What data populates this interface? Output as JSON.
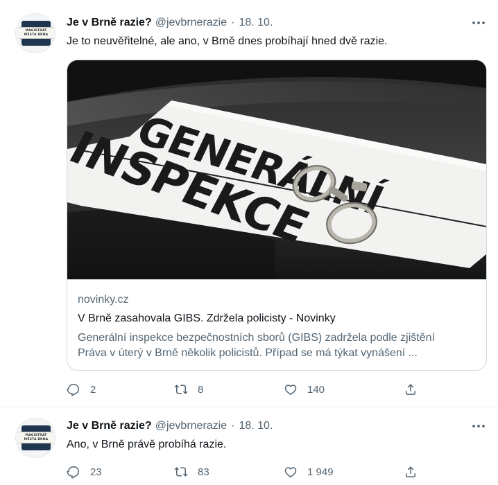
{
  "tweets": [
    {
      "author_name": "Je v Brně razie?",
      "author_handle": "@jevbrnerazie",
      "separator": "·",
      "date": "18. 10.",
      "text": "Je to neuvěřitelné, ale ano, v Brně dnes probíhají hned dvě razie.",
      "avatar_sign_line1": "MAGISTRÁT",
      "avatar_sign_line2": "MĚSTA BRNA",
      "card": {
        "image_alt": "Car hood with a sign reading GENERÁLNÍ INSPEKCE and handcuffs",
        "image_sign_line1": "GENERÁLNÍ",
        "image_sign_line2": "INSPEKCE",
        "domain": "novinky.cz",
        "title": "V Brně zasahovala GIBS. Zdržela policisty - Novinky",
        "description_line1": "Generální inspekce bezpečnostních sborů (GIBS) zadržela podle zjištění",
        "description_line2": "Práva v úterý v Brně několik policistů. Případ se má týkat vynášení ..."
      },
      "replies": "2",
      "retweets": "8",
      "likes": "140"
    },
    {
      "author_name": "Je v Brně razie?",
      "author_handle": "@jevbrnerazie",
      "separator": "·",
      "date": "18. 10.",
      "text": "Ano, v Brně právě probíhá razie.",
      "avatar_sign_line1": "MAGISTRÁT",
      "avatar_sign_line2": "MĚSTA BRNA",
      "replies": "23",
      "retweets": "83",
      "likes": "1 949"
    }
  ],
  "icons": {
    "more": "more-horizontal-icon",
    "reply": "reply-icon",
    "retweet": "retweet-icon",
    "like": "heart-icon",
    "share": "share-icon"
  },
  "colors": {
    "text_primary": "#0f1419",
    "text_secondary": "#536471",
    "border": "#cfd9de"
  }
}
